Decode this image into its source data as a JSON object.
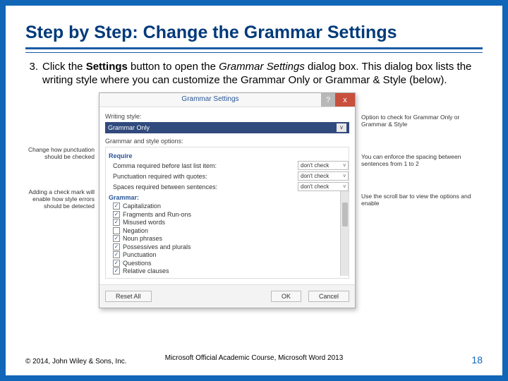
{
  "heading": "Step by Step: Change the Grammar Settings",
  "step_number": "3.",
  "step_text_pre": "Click the ",
  "step_bold": "Settings ",
  "step_text_mid": "button to open the ",
  "step_italic": "Grammar Settings",
  "step_text_post": " dialog box. This dialog box lists the writing style where you can customize the Grammar Only or Grammar & Style (below).",
  "dialog": {
    "title": "Grammar Settings",
    "help": "?",
    "close": "x",
    "writing_style_label": "Writing style:",
    "writing_style_value": "Grammar Only",
    "options_label": "Grammar and style options:",
    "require_label": "Require",
    "grammar_label": "Grammar:",
    "require_rows": [
      {
        "label": "Comma required before last list item:",
        "value": "don't check"
      },
      {
        "label": "Punctuation required with quotes:",
        "value": "don't check"
      },
      {
        "label": "Spaces required between sentences:",
        "value": "don't check"
      }
    ],
    "grammar_rows": [
      {
        "label": "Capitalization",
        "checked": true
      },
      {
        "label": "Fragments and Run-ons",
        "checked": true
      },
      {
        "label": "Misused words",
        "checked": true
      },
      {
        "label": "Negation",
        "checked": false
      },
      {
        "label": "Noun phrases",
        "checked": true
      },
      {
        "label": "Possessives and plurals",
        "checked": true
      },
      {
        "label": "Punctuation",
        "checked": true
      },
      {
        "label": "Questions",
        "checked": true
      },
      {
        "label": "Relative clauses",
        "checked": true
      }
    ],
    "buttons": {
      "reset": "Reset All",
      "ok": "OK",
      "cancel": "Cancel"
    }
  },
  "callouts": {
    "left1": "Change how punctuation should be checked",
    "left2": "Adding a check mark will enable how style errors should be detected",
    "right1": "Option to check for Grammar Only or Grammar & Style",
    "right2": "You can enforce the spacing between sentences from 1 to 2",
    "right3": "Use the scroll bar to view the options and enable"
  },
  "footer": {
    "copyright": "© 2014, John Wiley & Sons, Inc.",
    "center": "Microsoft Official Academic Course, Microsoft Word 2013",
    "page": "18"
  }
}
